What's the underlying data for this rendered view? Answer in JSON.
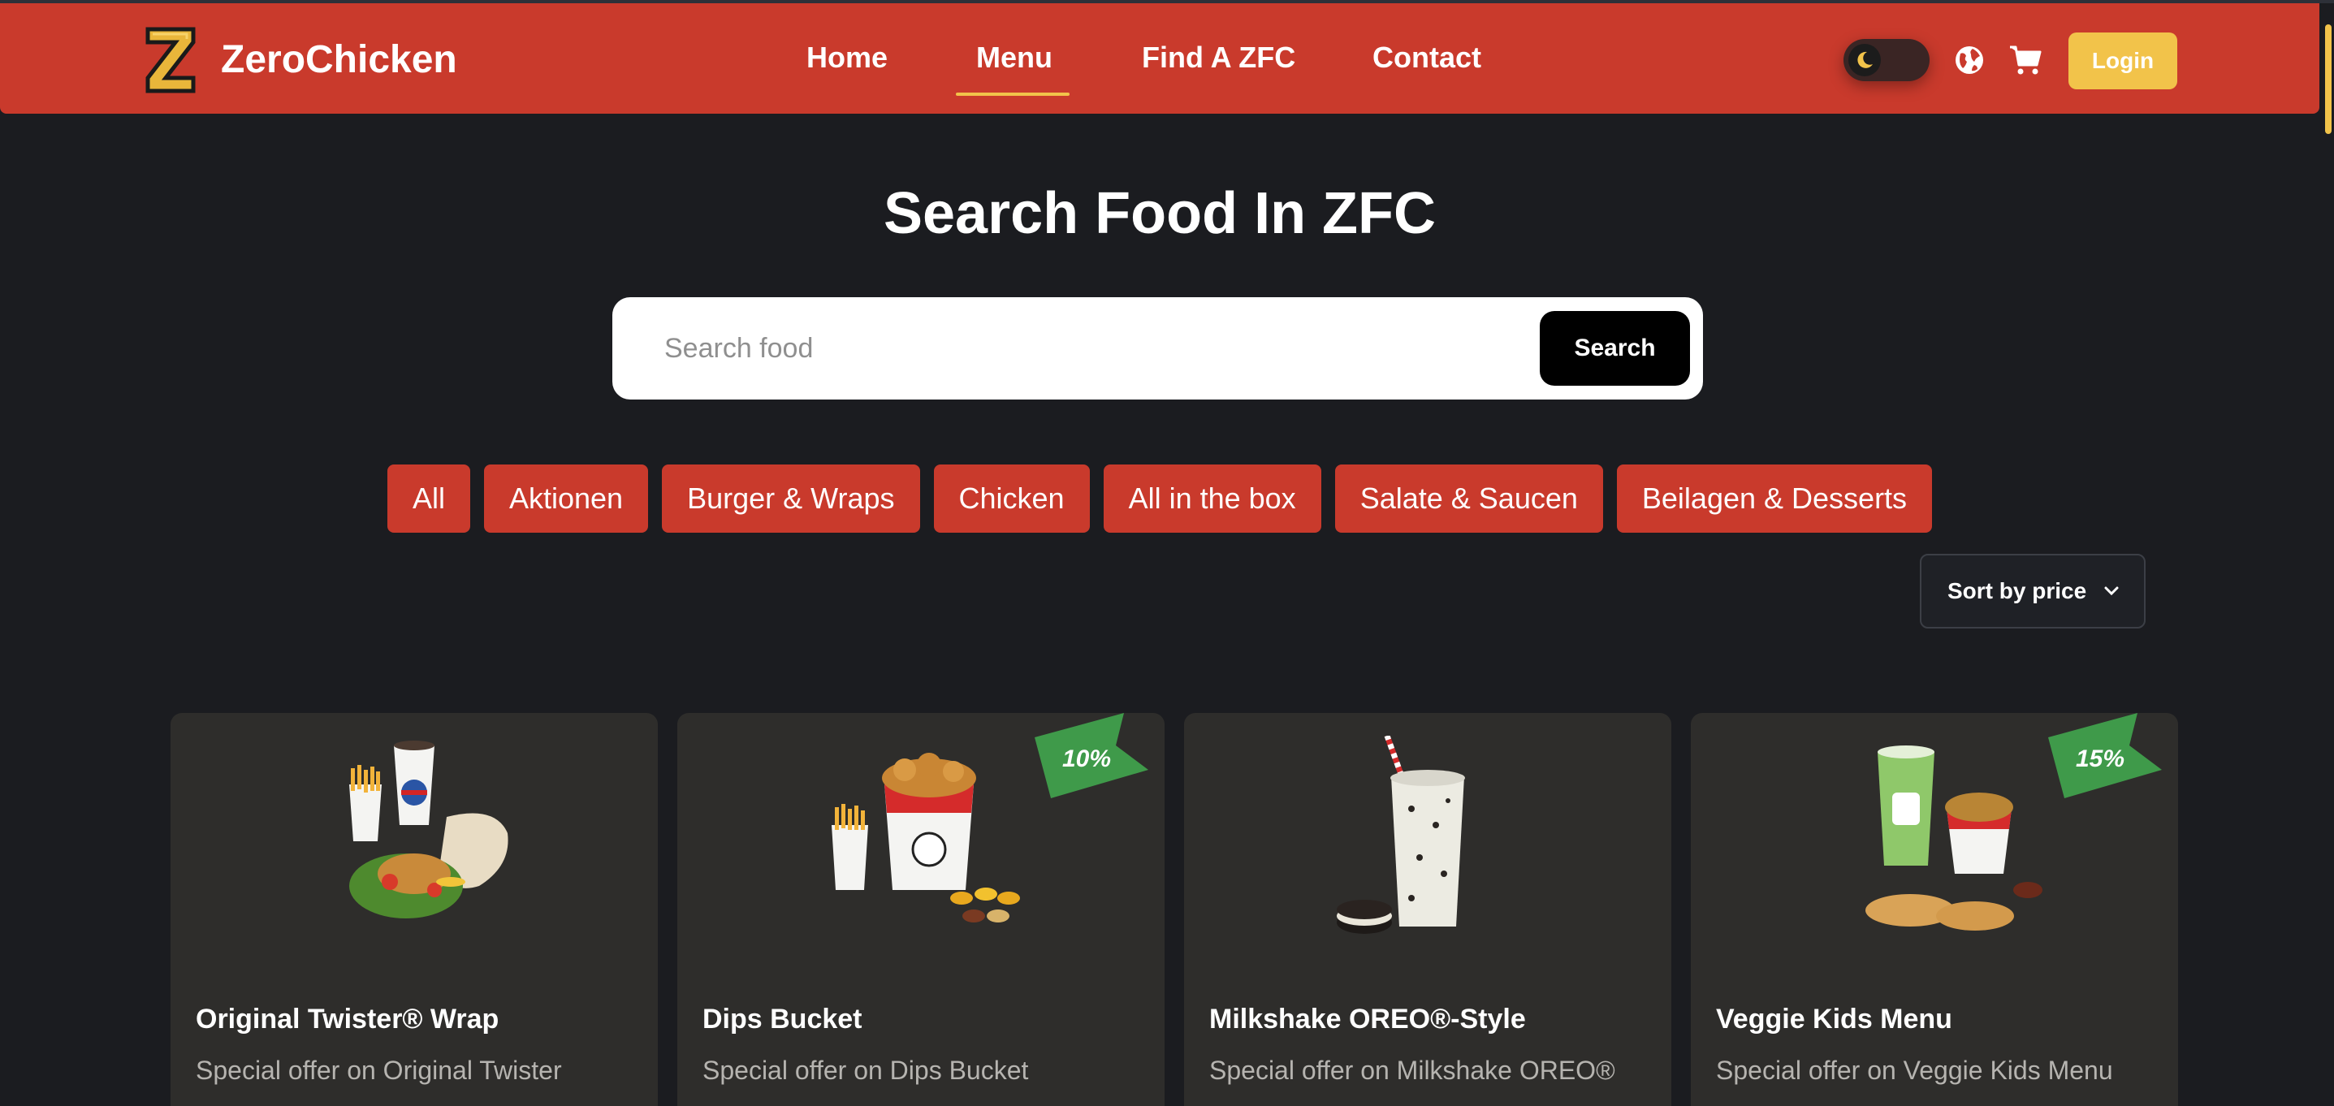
{
  "header": {
    "brand": "ZeroChicken",
    "nav": [
      {
        "label": "Home",
        "active": false
      },
      {
        "label": "Menu",
        "active": true
      },
      {
        "label": "Find A ZFC",
        "active": false
      },
      {
        "label": "Contact",
        "active": false
      }
    ],
    "login_label": "Login",
    "theme_toggle_icon": "moon-icon",
    "accent_color": "#c93a2c",
    "highlight_color": "#f2c34a"
  },
  "search": {
    "title": "Search Food In ZFC",
    "placeholder": "Search food",
    "button_label": "Search"
  },
  "categories": [
    "All",
    "Aktionen",
    "Burger & Wraps",
    "Chicken",
    "All in the box",
    "Salate & Saucen",
    "Beilagen & Desserts"
  ],
  "sort": {
    "label": "Sort by price"
  },
  "products": [
    {
      "name": "Original Twister® Wrap",
      "description": "Special offer on Original Twister",
      "discount": ""
    },
    {
      "name": "Dips Bucket",
      "description": "Special offer on Dips Bucket",
      "discount": "10%"
    },
    {
      "name": "Milkshake OREO®-Style",
      "description": "Special offer on Milkshake OREO®",
      "discount": ""
    },
    {
      "name": "Veggie Kids Menu",
      "description": "Special offer on Veggie Kids Menu",
      "discount": "15%"
    }
  ]
}
